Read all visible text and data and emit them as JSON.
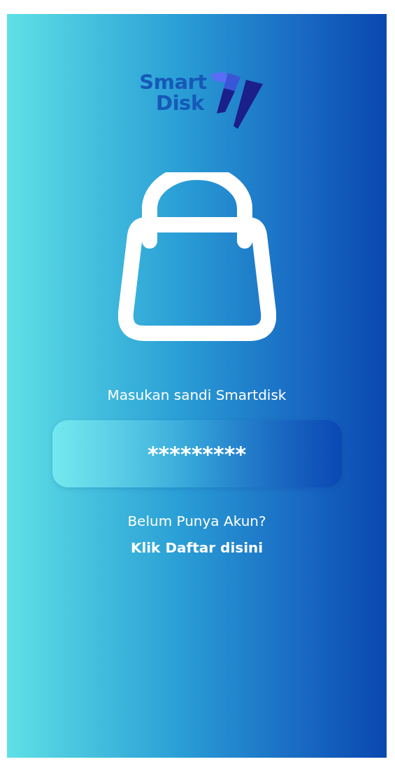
{
  "logo": {
    "line_1": "Smart",
    "line_2": "Disk"
  },
  "prompt": "Masukan sandi Smartdisk",
  "password_field": {
    "value": "*********"
  },
  "signup": {
    "question": "Belum Punya Akun?",
    "link": "Klik Daftar disini"
  }
}
